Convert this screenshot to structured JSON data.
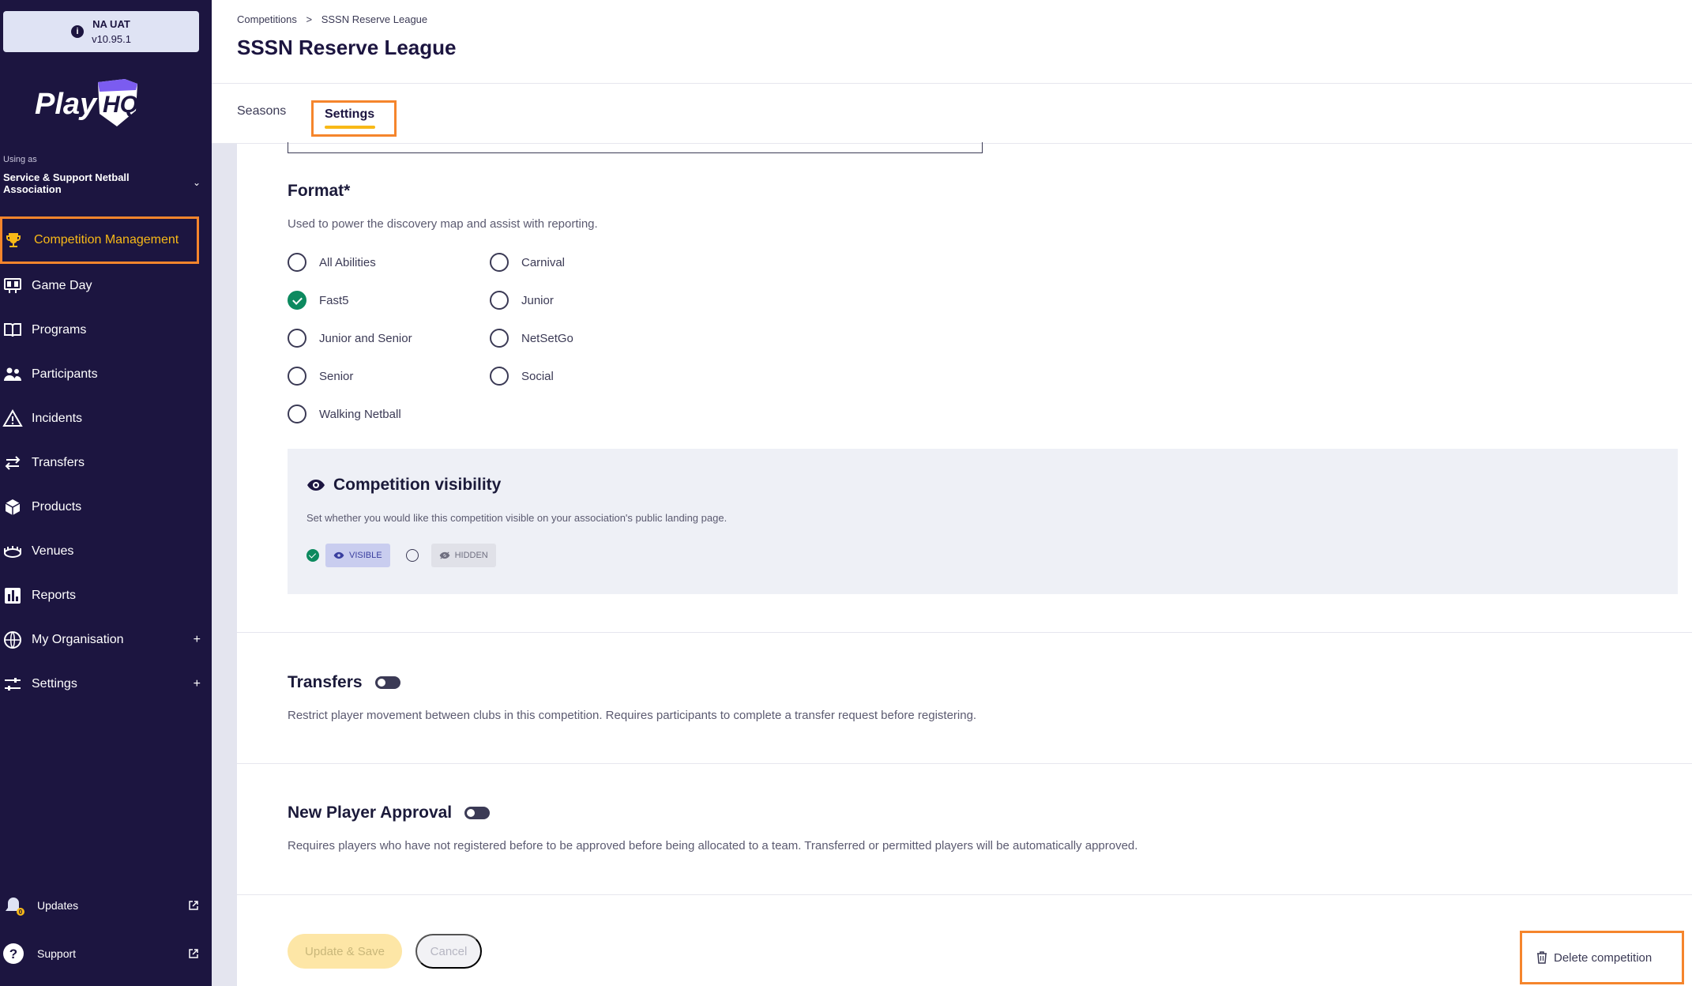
{
  "env": {
    "name": "NA UAT",
    "version": "v10.95.1"
  },
  "brand": {
    "logo_text": "PlayHQ"
  },
  "org": {
    "using_as": "Using as",
    "name": "Service & Support Netball Association"
  },
  "nav": {
    "items": [
      {
        "label": "Competition Management",
        "icon": "trophy-icon",
        "active": true
      },
      {
        "label": "Game Day",
        "icon": "scoreboard-icon"
      },
      {
        "label": "Programs",
        "icon": "book-icon"
      },
      {
        "label": "Participants",
        "icon": "people-icon"
      },
      {
        "label": "Incidents",
        "icon": "warning-icon"
      },
      {
        "label": "Transfers",
        "icon": "arrows-icon"
      },
      {
        "label": "Products",
        "icon": "box-icon"
      },
      {
        "label": "Venues",
        "icon": "stadium-icon"
      },
      {
        "label": "Reports",
        "icon": "chart-icon"
      },
      {
        "label": "My Organisation",
        "icon": "globe-icon",
        "expandable": true
      },
      {
        "label": "Settings",
        "icon": "sliders-icon",
        "expandable": true
      }
    ],
    "plus": "+",
    "updates": "Updates",
    "updates_badge": "0",
    "support": "Support"
  },
  "header": {
    "breadcrumb": [
      "Competitions",
      ">",
      "SSSN Reserve League"
    ],
    "title": "SSSN Reserve League"
  },
  "tabs": [
    {
      "label": "Seasons"
    },
    {
      "label": "Settings",
      "active": true
    }
  ],
  "format": {
    "title": "Format*",
    "description": "Used to power the discovery map and assist with reporting.",
    "options": [
      {
        "label": "All Abilities",
        "checked": false
      },
      {
        "label": "Carnival",
        "checked": false
      },
      {
        "label": "Fast5",
        "checked": true
      },
      {
        "label": "Junior",
        "checked": false
      },
      {
        "label": "Junior and Senior",
        "checked": false
      },
      {
        "label": "NetSetGo",
        "checked": false
      },
      {
        "label": "Senior",
        "checked": false
      },
      {
        "label": "Social",
        "checked": false
      },
      {
        "label": "Walking Netball",
        "checked": false
      }
    ]
  },
  "visibility": {
    "title": "Competition visibility",
    "description": "Set whether you would like this competition visible on your association's public landing page.",
    "visible_label": "VISIBLE",
    "hidden_label": "HIDDEN",
    "selected": "VISIBLE"
  },
  "transfers": {
    "title": "Transfers",
    "enabled": false,
    "description": "Restrict player movement between clubs in this competition. Requires participants to complete a transfer request before registering."
  },
  "new_player_approval": {
    "title": "New Player Approval",
    "enabled": false,
    "description": "Requires players who have not registered before to be approved before being allocated to a team. Transferred or permitted players will be automatically approved."
  },
  "actions": {
    "save": "Update & Save",
    "cancel": "Cancel",
    "delete": "Delete competition"
  },
  "colors": {
    "sidebar": "#1c1540",
    "accent": "#f8b917",
    "highlight": "#f5852c",
    "success": "#0d8a5f"
  }
}
